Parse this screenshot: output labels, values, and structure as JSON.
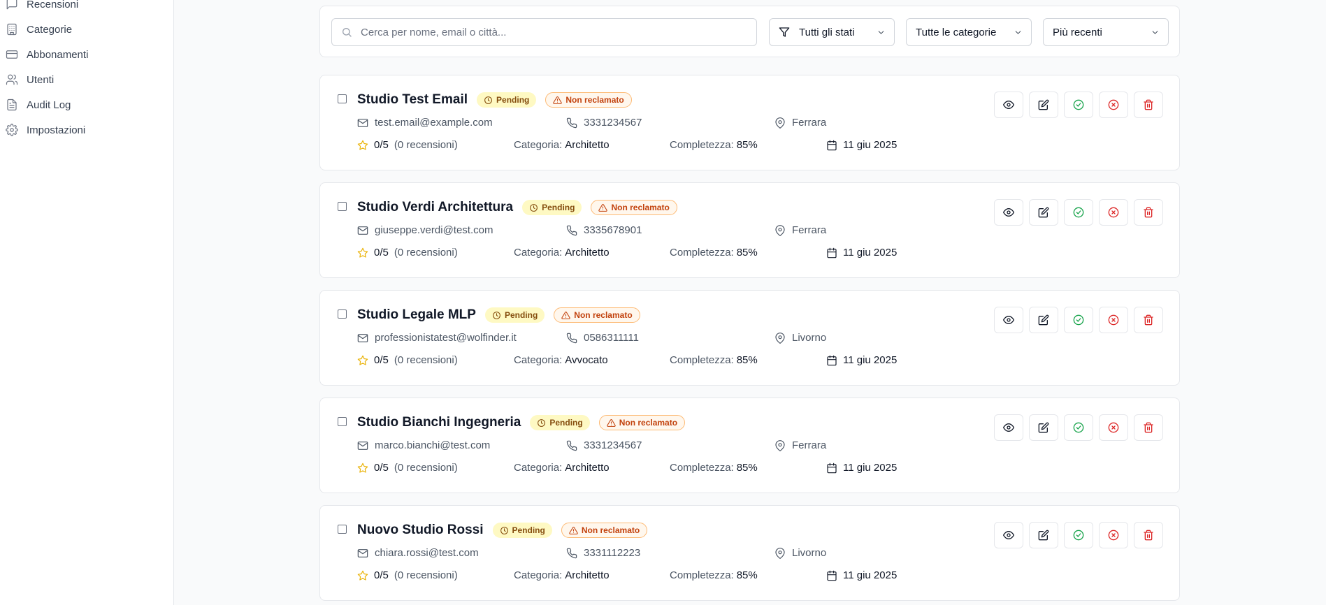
{
  "sidebar": {
    "items": [
      {
        "label": "Recensioni",
        "icon": "message-square-icon"
      },
      {
        "label": "Categorie",
        "icon": "building-icon"
      },
      {
        "label": "Abbonamenti",
        "icon": "credit-card-icon"
      },
      {
        "label": "Utenti",
        "icon": "users-icon"
      },
      {
        "label": "Audit Log",
        "icon": "file-text-icon"
      },
      {
        "label": "Impostazioni",
        "icon": "gear-icon"
      }
    ]
  },
  "filters": {
    "search_placeholder": "Cerca per nome, email o città...",
    "status": "Tutti gli stati",
    "category": "Tutte le categorie",
    "sort": "Più recenti"
  },
  "labels": {
    "category_prefix": "Categoria:",
    "completeness_prefix": "Completezza:"
  },
  "professionals": [
    {
      "name": "Studio Test Email",
      "status": "Pending",
      "claim": "Non reclamato",
      "email": "test.email@example.com",
      "phone": "3331234567",
      "city": "Ferrara",
      "rating": "0/5",
      "reviews": "(0 recensioni)",
      "category": "Architetto",
      "completeness": "85%",
      "date": "11 giu 2025"
    },
    {
      "name": "Studio Verdi Architettura",
      "status": "Pending",
      "claim": "Non reclamato",
      "email": "giuseppe.verdi@test.com",
      "phone": "3335678901",
      "city": "Ferrara",
      "rating": "0/5",
      "reviews": "(0 recensioni)",
      "category": "Architetto",
      "completeness": "85%",
      "date": "11 giu 2025"
    },
    {
      "name": "Studio Legale MLP",
      "status": "Pending",
      "claim": "Non reclamato",
      "email": "professionistatest@wolfinder.it",
      "phone": "0586311111",
      "city": "Livorno",
      "rating": "0/5",
      "reviews": "(0 recensioni)",
      "category": "Avvocato",
      "completeness": "85%",
      "date": "11 giu 2025"
    },
    {
      "name": "Studio Bianchi Ingegneria",
      "status": "Pending",
      "claim": "Non reclamato",
      "email": "marco.bianchi@test.com",
      "phone": "3331234567",
      "city": "Ferrara",
      "rating": "0/5",
      "reviews": "(0 recensioni)",
      "category": "Architetto",
      "completeness": "85%",
      "date": "11 giu 2025"
    },
    {
      "name": "Nuovo Studio Rossi",
      "status": "Pending",
      "claim": "Non reclamato",
      "email": "chiara.rossi@test.com",
      "phone": "3331112223",
      "city": "Livorno",
      "rating": "0/5",
      "reviews": "(0 recensioni)",
      "category": "Architetto",
      "completeness": "85%",
      "date": "11 giu 2025"
    }
  ],
  "colors": {
    "pending_bg": "#fef9c3",
    "unclaimed_border": "#fdba74",
    "approve": "#16a34a",
    "reject": "#dc2626",
    "star": "#eab308"
  }
}
